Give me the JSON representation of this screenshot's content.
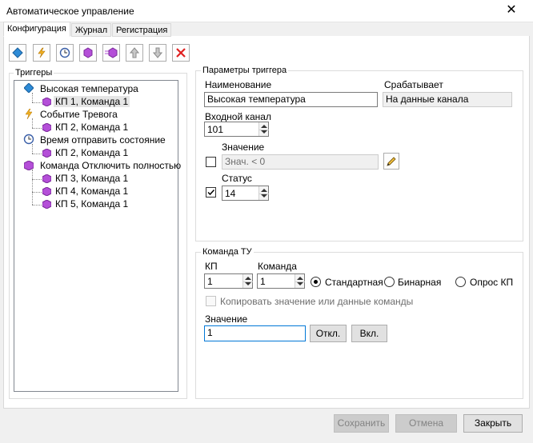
{
  "window": {
    "title": "Автоматическое управление",
    "close_glyph": "✕"
  },
  "tabs": [
    {
      "label": "Конфигурация",
      "active": true
    },
    {
      "label": "Журнал",
      "active": false
    },
    {
      "label": "Регистрация",
      "active": false
    }
  ],
  "toolbar": {
    "icons": [
      "diamond-trigger-icon",
      "lightning-event-icon",
      "clock-timer-icon",
      "purple-command-icon",
      "add-command-icon",
      "move-up-icon",
      "move-down-icon",
      "delete-icon"
    ]
  },
  "triggers": {
    "group_label": "Триггеры",
    "items": [
      {
        "label": "Высокая температура",
        "icon": "diamond-icon",
        "children": [
          "КП 1, Команда 1"
        ]
      },
      {
        "label": "Событие Тревога",
        "icon": "lightning-icon",
        "children": [
          "КП 2, Команда 1"
        ]
      },
      {
        "label": "Время отправить состояние",
        "icon": "clock-icon",
        "children": [
          "КП 2, Команда 1"
        ]
      },
      {
        "label": "Команда Отключить полностью",
        "icon": "purple-command-icon",
        "children": [
          "КП 3, Команда 1",
          "КП 4, Команда 1",
          "КП 5, Команда 1"
        ]
      }
    ]
  },
  "trigger_params": {
    "group_label": "Параметры триггера",
    "name_label": "Наименование",
    "name_value": "Высокая температура",
    "fires_label": "Срабатывает",
    "fires_value": "На данные канала",
    "input_channel_label": "Входной канал",
    "input_channel_value": "101",
    "value_label": "Значение",
    "value_placeholder": "Знач. < 0",
    "value_checked": false,
    "status_label": "Статус",
    "status_value": "14",
    "status_checked": true
  },
  "command": {
    "group_label": "Команда ТУ",
    "kp_label": "КП",
    "kp_value": "1",
    "cmd_label": "Команда",
    "cmd_value": "1",
    "radios": [
      {
        "label": "Стандартная",
        "selected": true
      },
      {
        "label": "Бинарная",
        "selected": false
      },
      {
        "label": "Опрос КП",
        "selected": false
      }
    ],
    "copy_label": "Копировать значение или данные команды",
    "value_label": "Значение",
    "value": "1",
    "off_button": "Откл.",
    "on_button": "Вкл."
  },
  "footer": {
    "save": "Сохранить",
    "cancel": "Отмена",
    "close": "Закрыть"
  },
  "colors": {
    "accent": "#0078d7",
    "diamond": "#2e8bd6",
    "lightning": "#f0b020",
    "command": "#b44fd8"
  }
}
